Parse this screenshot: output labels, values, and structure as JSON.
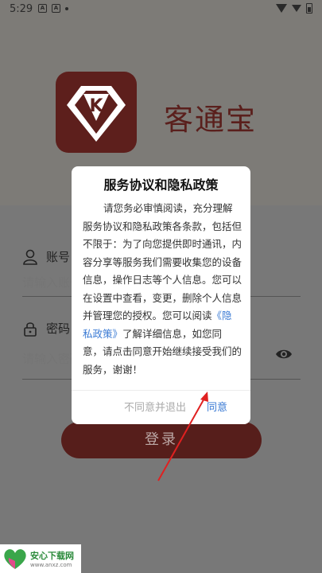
{
  "status_bar": {
    "time": "5:29",
    "left_icons": [
      "a-box-icon",
      "a-box-icon",
      "dot-icon"
    ]
  },
  "app": {
    "name": "客通宝",
    "logo_letter": "K",
    "brand_color": "#5d1f1c"
  },
  "login_form": {
    "account_label": "账号",
    "account_placeholder": "请输入账号",
    "password_label": "密码",
    "password_placeholder": "请输入密码",
    "login_button": "登录"
  },
  "dialog": {
    "title": "服务协议和隐私政策",
    "body_before_link": "请您务必审慎阅读，充分理解服务协议和隐私政策各条款，包括但不限于：为了向您提供即时通讯，内容分享等服务我们需要收集您的设备信息，操作日志等个人信息。您可以在设置中查看，变更，删除个人信息并管理您的授权。您可以阅读",
    "link_text": "《隐私政策》",
    "body_after_link": "了解详细信息，如您同意，请点击同意开始继续接受我们的服务，谢谢！",
    "disagree_button": "不同意并退出",
    "agree_button": "同意",
    "link_color": "#3b7bd4"
  },
  "watermark": {
    "title": "安心下载网",
    "url": "www.anxz.com"
  }
}
